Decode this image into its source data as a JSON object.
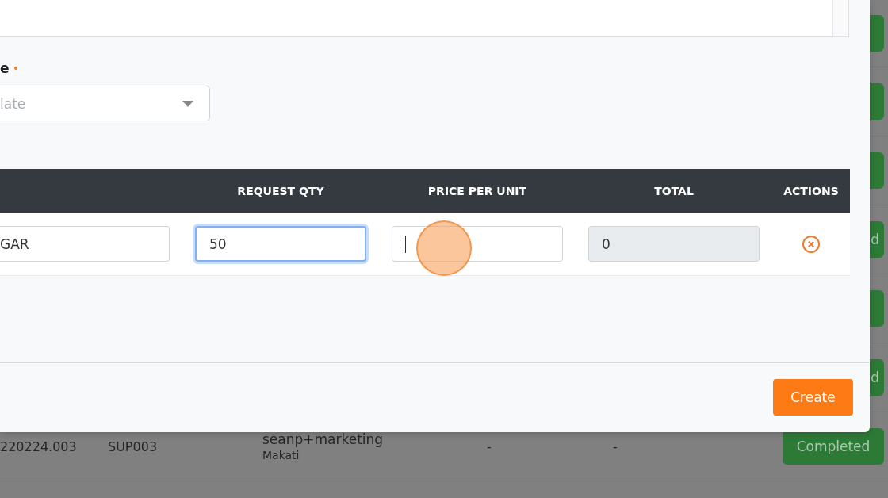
{
  "background_table": {
    "rows": [
      {},
      {},
      {},
      {
        "status": "d"
      },
      {},
      {
        "status": "d"
      },
      {
        "cells": [
          "220224.003",
          "SUP003"
        ],
        "supplier": "seanp+marketing",
        "location": "Makati",
        "column_5": "-",
        "column_6": "-",
        "status": "Completed"
      }
    ]
  },
  "modal": {
    "field_label": "e",
    "required": true,
    "select": {
      "placeholder": "late"
    },
    "table": {
      "columns": [
        {
          "label": "REQUEST QTY"
        },
        {
          "label": "PRICE PER UNIT"
        },
        {
          "label": "TOTAL"
        },
        {
          "label": "ACTIONS"
        }
      ],
      "rows": [
        {
          "fields": [
            {
              "kind": "text",
              "value": "GAR",
              "focused": false,
              "caret": false
            },
            {
              "kind": "text",
              "value": "50",
              "focused": true,
              "caret": false
            },
            {
              "kind": "text",
              "focused": false,
              "caret": true
            },
            {
              "kind": "readonly",
              "value": "0",
              "focused": false,
              "caret": false
            }
          ]
        }
      ]
    },
    "create_button": "Create"
  }
}
